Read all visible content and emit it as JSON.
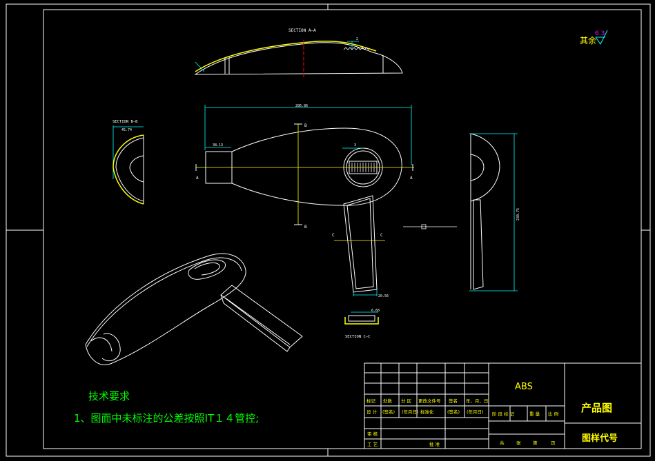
{
  "colors": {
    "background": "#000000",
    "white": "#ffffff",
    "yellow": "#ffff00",
    "cyan": "#00ffff",
    "green": "#00ff00",
    "magenta": "#ff00ff",
    "red": "#ff0000"
  },
  "views": {
    "section_aa_label": "SECTION A—A",
    "section_bb_label": "SECTION B—B",
    "section_cc_label": "SECTION C—C",
    "cut_label_a": "A",
    "cut_label_b": "B",
    "cut_label_c": "C",
    "dim_overall_length": "286.86",
    "dim_nozzle_length": "38.13",
    "dim_section_bb_width": "45.74",
    "dim_side_height": "230.75",
    "dim_handle_width": "20.56",
    "dim_section_cc": "6.68",
    "dim_section_aa_small": "2",
    "dim_grille_small": "3"
  },
  "roughness": {
    "label": "其余",
    "value": "6.3"
  },
  "notes": {
    "heading": "技术要求",
    "item1": "1、图面中未标注的公差按照IT１４管控;"
  },
  "title_block": {
    "material": "ABS",
    "drawing_title": "产品图",
    "drawing_code_label": "图样代号",
    "row_marks": [
      "标记",
      "处数",
      "分 区",
      "更改文件号",
      "签名",
      "年、月、日"
    ],
    "row_design": [
      "设 计",
      "(签名)",
      "(年月日)",
      "标准化",
      "(签名)",
      "(年月日)"
    ],
    "stage_row": [
      "阶 段 标 记",
      "重 量",
      "比 例"
    ],
    "review_label": "审 核",
    "process_label": "工 艺",
    "approve_label": "批 准",
    "sheet_row": [
      "共",
      "张",
      "第",
      "页"
    ]
  }
}
